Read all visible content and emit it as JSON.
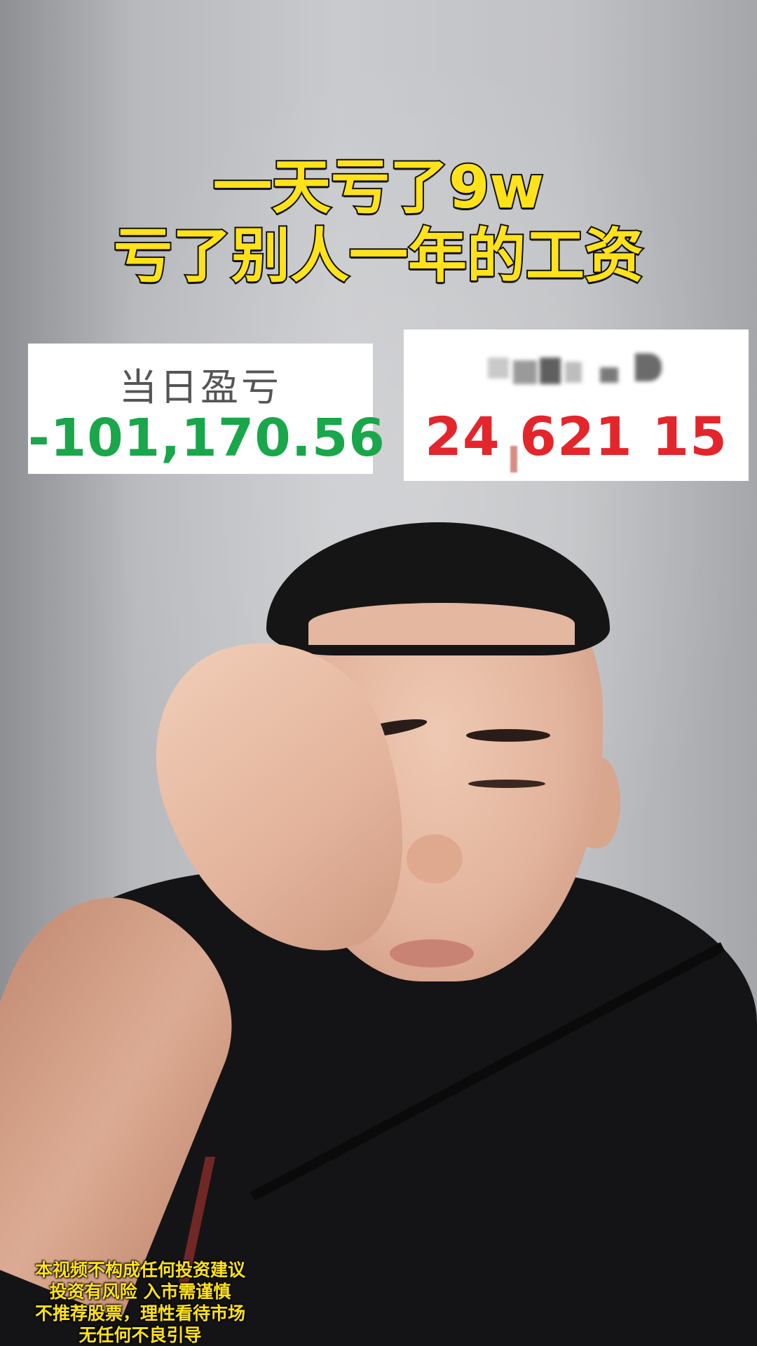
{
  "title": {
    "line1": "一天亏了9w",
    "line2": "亏了别人一年的工资"
  },
  "cards": {
    "left": {
      "label": "当日盈亏",
      "value": "-101,170.56",
      "value_color": "#1aa64a"
    },
    "right": {
      "label_obscured": true,
      "value": "24 621 15",
      "value_color": "#e3262c"
    }
  },
  "disclaimer": {
    "line1": "本视频不构成任何投资建议",
    "line2": "投资有风险 入市需谨慎",
    "line3": "不推荐股票，理性看待市场",
    "line4": "无任何不良引导"
  },
  "colors": {
    "title_yellow": "#ffe21a",
    "card_bg": "#ffffff"
  }
}
